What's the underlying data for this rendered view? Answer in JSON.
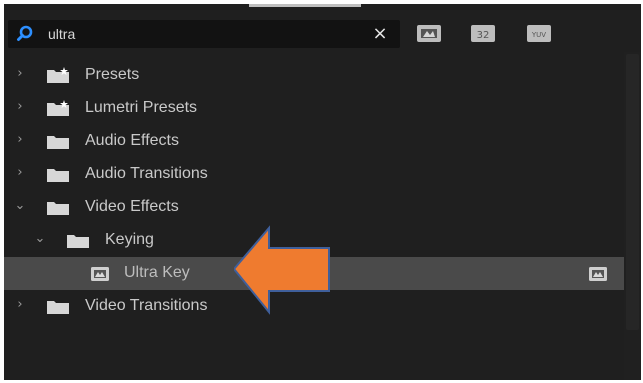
{
  "search": {
    "value": "ultra",
    "clear_symbol": "×"
  },
  "filters": [
    {
      "name": "accelerated-effects-icon"
    },
    {
      "name": "32-bit-color-icon",
      "text": "32"
    },
    {
      "name": "yuv-effects-icon",
      "text": "YUV"
    }
  ],
  "tree": [
    {
      "label": "Presets",
      "expanded": false,
      "level": 0,
      "icon": "star-folder-icon"
    },
    {
      "label": "Lumetri Presets",
      "expanded": false,
      "level": 0,
      "icon": "star-folder-icon"
    },
    {
      "label": "Audio Effects",
      "expanded": false,
      "level": 0,
      "icon": "folder-icon"
    },
    {
      "label": "Audio Transitions",
      "expanded": false,
      "level": 0,
      "icon": "folder-icon"
    },
    {
      "label": "Video Effects",
      "expanded": true,
      "level": 0,
      "icon": "folder-icon"
    },
    {
      "label": "Keying",
      "expanded": true,
      "level": 1,
      "icon": "folder-icon"
    },
    {
      "label": "Ultra Key",
      "selected": true,
      "level": 2,
      "icon": "effect-icon",
      "right_icon": "accelerated-effect-icon"
    },
    {
      "label": "Video Transitions",
      "expanded": false,
      "level": 0,
      "icon": "folder-icon"
    }
  ],
  "overlay": {
    "arrow_color": "#ef7b2f",
    "arrow_outline": "#3f5f9b"
  }
}
